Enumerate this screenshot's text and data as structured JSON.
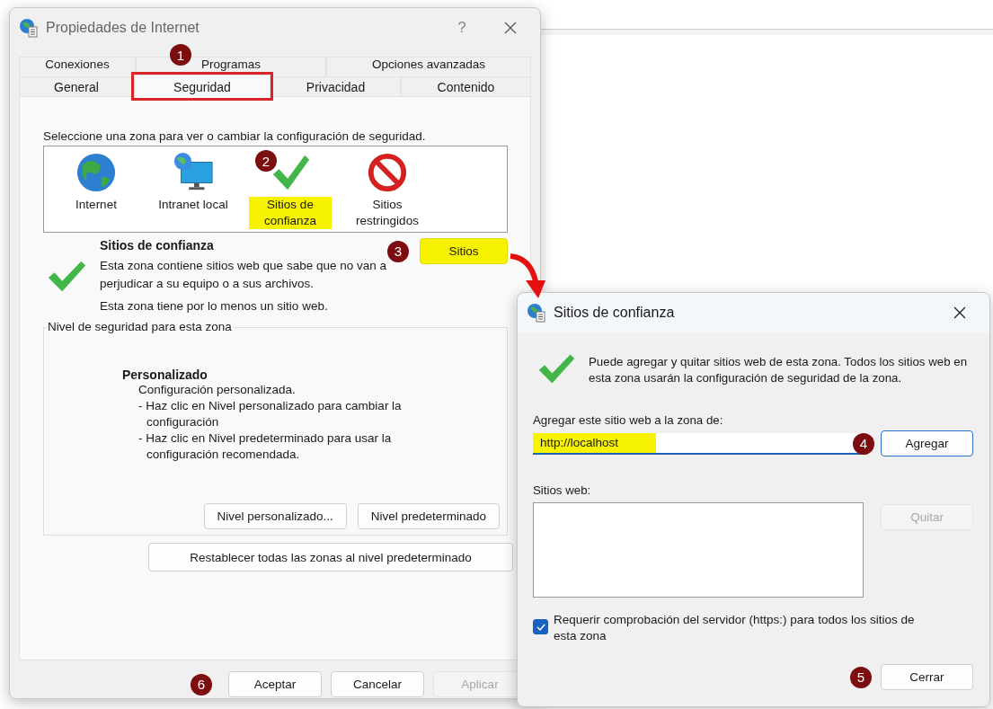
{
  "main_window": {
    "title": "Propiedades de Internet",
    "help": "?"
  },
  "tab_rows": [
    {
      "tabs": [
        {
          "label": "Conexiones",
          "selected": false,
          "outlined": false
        },
        {
          "label": "Programas",
          "selected": false,
          "outlined": false
        },
        {
          "label": "Opciones avanzadas",
          "selected": false,
          "outlined": false
        }
      ]
    },
    {
      "tabs": [
        {
          "label": "General",
          "selected": false,
          "outlined": false
        },
        {
          "label": "Seguridad",
          "selected": true,
          "outlined": true,
          "marker": "1"
        },
        {
          "label": "Privacidad",
          "selected": false,
          "outlined": false
        },
        {
          "label": "Contenido",
          "selected": false,
          "outlined": false
        }
      ]
    }
  ],
  "zone_prompt": "Seleccione una zona para ver o cambiar la configuración de seguridad.",
  "zones": [
    {
      "kind": "internet",
      "label": "Internet",
      "highlighted": false
    },
    {
      "kind": "intranet",
      "label": "Intranet local",
      "highlighted": false
    },
    {
      "kind": "trusted",
      "label": "Sitios de confianza",
      "highlighted": true,
      "marker": "2"
    },
    {
      "kind": "restricted",
      "label": "Sitios restringidos",
      "highlighted": false
    }
  ],
  "zone_info": {
    "title": "Sitios de confianza",
    "description": "Esta zona contiene sitios web que sabe que no van a perjudicar a su equipo o a sus archivos.",
    "note": "Esta zona tiene por lo menos un sitio web.",
    "sites_button": {
      "label": "Sitios",
      "highlighted": true,
      "marker": "3"
    }
  },
  "security_level": {
    "legend": "Nivel de seguridad para esta zona",
    "level_name": "Personalizado",
    "details": [
      "Configuración personalizada.",
      "- Haz clic en Nivel personalizado para cambiar la configuración",
      "- Haz clic en Nivel predeterminado para usar la configuración recomendada."
    ],
    "buttons": [
      {
        "label": "Nivel personalizado..."
      },
      {
        "label": "Nivel predeterminado"
      }
    ]
  },
  "reset_button": "Restablecer todas las zonas al nivel predeterminado",
  "footer_buttons": [
    {
      "label": "Aceptar",
      "disabled": false,
      "marker": "6"
    },
    {
      "label": "Cancelar",
      "disabled": false
    },
    {
      "label": "Aplicar",
      "disabled": true
    }
  ],
  "sites_dialog": {
    "title": "Sitios de confianza",
    "message": "Puede agregar y quitar sitios web de esta zona. Todos los sitios web en esta zona usarán la configuración de seguridad de la zona.",
    "add_label": "Agregar este sitio web a la zona de:",
    "url_field": {
      "value": "http://localhost",
      "highlighted": true,
      "marker": "4"
    },
    "add_button": {
      "label": "Agregar",
      "disabled": false
    },
    "sites_label": "Sitios web:",
    "remove_button": {
      "label": "Quitar",
      "disabled": true
    },
    "https_check": {
      "label": "Requerir comprobación del servidor (https:) para todos los sitios de esta zona",
      "checked": true
    },
    "close_button": {
      "label": "Cerrar",
      "marker": "5"
    }
  }
}
